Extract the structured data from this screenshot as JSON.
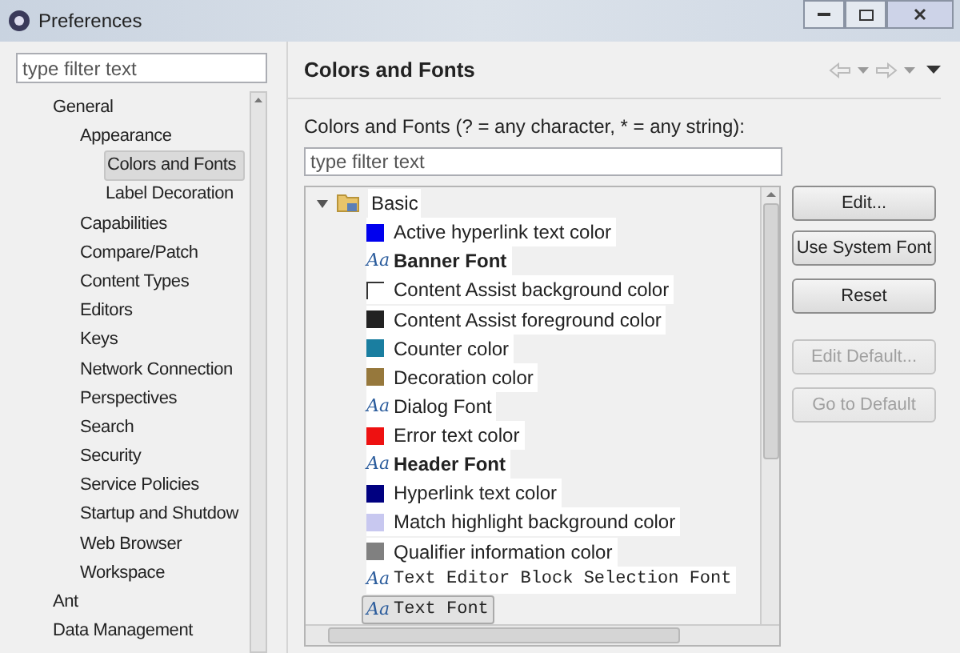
{
  "window": {
    "title": "Preferences"
  },
  "sidebar": {
    "filter": {
      "placeholder": "type filter text"
    },
    "tree": [
      {
        "label": "General",
        "selected": false,
        "children": [
          {
            "label": "Appearance",
            "selected": false,
            "children": [
              {
                "label": "Colors and Fonts",
                "selected": true
              },
              {
                "label": "Label Decoration",
                "selected": false
              }
            ]
          },
          {
            "label": "Capabilities",
            "selected": false
          },
          {
            "label": "Compare/Patch",
            "selected": false
          },
          {
            "label": "Content Types",
            "selected": false
          },
          {
            "label": "Editors",
            "selected": false
          },
          {
            "label": "Keys",
            "selected": false
          },
          {
            "label": "Network Connection",
            "selected": false
          },
          {
            "label": "Perspectives",
            "selected": false
          },
          {
            "label": "Search",
            "selected": false
          },
          {
            "label": "Security",
            "selected": false
          },
          {
            "label": "Service Policies",
            "selected": false
          },
          {
            "label": "Startup and Shutdow",
            "selected": false
          },
          {
            "label": "Web Browser",
            "selected": false
          },
          {
            "label": "Workspace",
            "selected": false
          }
        ]
      },
      {
        "label": "Ant",
        "selected": false
      },
      {
        "label": "Data Management",
        "selected": false
      }
    ]
  },
  "page": {
    "title": "Colors and Fonts",
    "filter_label": "Colors and Fonts (? = any character, * = any string):",
    "filter": {
      "placeholder": "type filter text"
    },
    "tree": {
      "label": "Basic",
      "expanded": true,
      "children": [
        {
          "kind": "color",
          "label": "Active hyperlink text color",
          "color": "#0000ee",
          "selected": false
        },
        {
          "kind": "bold-font",
          "label": "Banner Font",
          "icon": "Aa",
          "selected": false
        },
        {
          "kind": "color",
          "label": "Content Assist background color",
          "color": "#ffffff",
          "selected": false
        },
        {
          "kind": "color",
          "label": "Content Assist foreground color",
          "color": "#222222",
          "selected": false
        },
        {
          "kind": "color",
          "label": "Counter color",
          "color": "#1a7ea0",
          "selected": false
        },
        {
          "kind": "color",
          "label": "Decoration color",
          "color": "#96783c",
          "selected": false
        },
        {
          "kind": "font",
          "label": "Dialog Font",
          "icon": "Aa",
          "selected": false
        },
        {
          "kind": "color",
          "label": "Error text color",
          "color": "#ee1111",
          "selected": false
        },
        {
          "kind": "bold-font",
          "label": "Header Font",
          "icon": "Aa",
          "selected": false
        },
        {
          "kind": "color",
          "label": "Hyperlink text color",
          "color": "#000080",
          "selected": false
        },
        {
          "kind": "color",
          "label": "Match highlight background color",
          "color": "#c8c8f0",
          "selected": false
        },
        {
          "kind": "color",
          "label": "Qualifier information color",
          "color": "#808080",
          "selected": false
        },
        {
          "kind": "mono-font",
          "label": "Text Editor Block Selection Font",
          "icon": "Aa",
          "selected": false
        },
        {
          "kind": "mono-font",
          "label": "Text Font",
          "icon": "Aa",
          "selected": true
        }
      ]
    },
    "buttons": [
      {
        "label": "Edit...",
        "disabled": false
      },
      {
        "label": "Use System Font",
        "disabled": false
      },
      {
        "label": "Reset",
        "disabled": false
      },
      {
        "label": "Edit Default...",
        "disabled": true
      },
      {
        "label": "Go to Default",
        "disabled": true
      }
    ]
  }
}
